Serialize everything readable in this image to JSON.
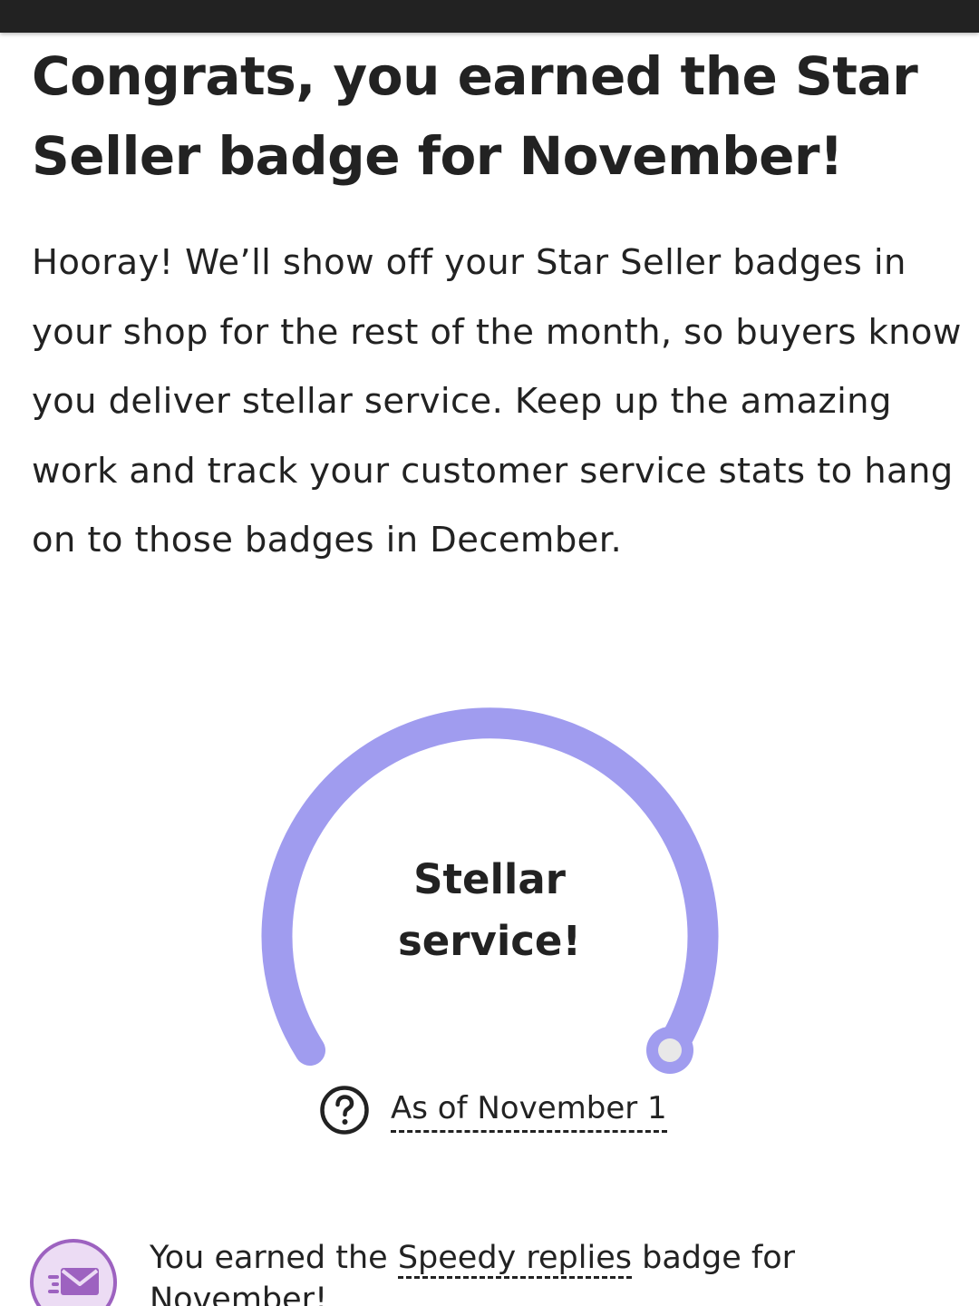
{
  "header": {
    "title": "Congrats, you earned the Star Seller badge for November!"
  },
  "intro": {
    "text": "Hooray! We’ll show off your Star Seller badges in your shop for the rest of the month, so buyers know you deliver stellar service. Keep up the amazing work and track your customer service stats to hang on to those badges in December."
  },
  "gauge": {
    "label_line1": "Stellar",
    "label_line2": "service!",
    "color": "#a09cef",
    "level": 1.0
  },
  "as_of": {
    "icon": "question-circle-icon",
    "text": "As of November 1"
  },
  "badge_row": {
    "icon": "envelope-icon",
    "text_before": "You earned the ",
    "link_text": "Speedy replies",
    "text_after": " badge for November!",
    "icon_color": "#9d62c0"
  }
}
